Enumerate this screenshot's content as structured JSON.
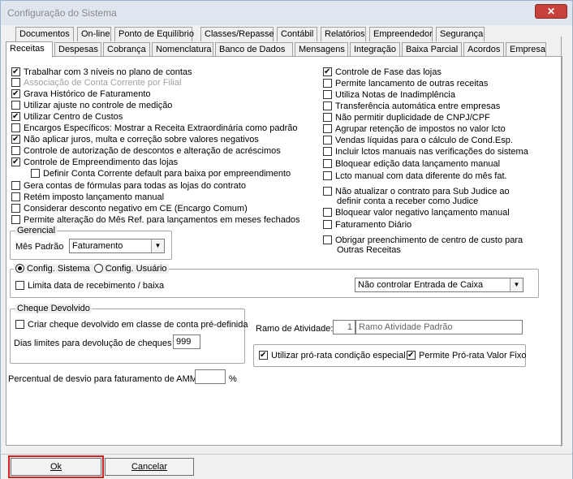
{
  "window": {
    "title": "Configuração do Sistema",
    "close_icon": "close-icon"
  },
  "tabs_row1": [
    "Documentos",
    "On-line",
    "Ponto de Equilíbrio",
    "Classes/Repasse",
    "Contábil",
    "Relatórios",
    "Empreendedor",
    "Segurança"
  ],
  "tabs_row2": [
    "Receitas",
    "Despesas",
    "Cobrança",
    "Nomenclatura",
    "Banco de Dados",
    "Mensagens",
    "Integração",
    "Baixa Parcial",
    "Acordos",
    "Empresa"
  ],
  "left_checks": [
    {
      "label": "Trabalhar com 3 níveis no plano de contas",
      "checked": true
    },
    {
      "label": "Associação de Conta Corrente por Filial",
      "checked": false,
      "disabled": true
    },
    {
      "label": "Grava Histórico de Faturamento",
      "checked": true
    },
    {
      "label": "Utilizar ajuste no controle de medição",
      "checked": false
    },
    {
      "label": "Utilizar Centro de Custos",
      "checked": true
    },
    {
      "label": "Encargos Específicos: Mostrar a Receita Extraordinária como padrão",
      "checked": false
    },
    {
      "label": "Não aplicar juros, multa e correção sobre valores negativos",
      "checked": true
    },
    {
      "label": "Controle de autorização de descontos e alteração de acréscimos",
      "checked": false
    },
    {
      "label": "Controle de Empreendimento das lojas",
      "checked": true
    },
    {
      "label": "Definir Conta Corrente default para baixa por empreendimento",
      "checked": false
    },
    {
      "label": "Gera contas de fórmulas para todas as lojas do contrato",
      "checked": false
    },
    {
      "label": "Retém imposto lançamento manual",
      "checked": false
    },
    {
      "label": "Considerar desconto negativo em CE (Encargo Comum)",
      "checked": false
    },
    {
      "label": "Permite alteração do Mês Ref. para lançamentos em meses fechados",
      "checked": false
    }
  ],
  "right_checks": [
    {
      "label": "Controle de Fase das lojas",
      "checked": true
    },
    {
      "label": "Permite lancamento de outras receitas",
      "checked": false
    },
    {
      "label": "Utiliza Notas de Inadimplência",
      "checked": false
    },
    {
      "label": "Transferência automática entre empresas",
      "checked": false
    },
    {
      "label": "Não permitir duplicidade de CNPJ/CPF",
      "checked": false
    },
    {
      "label": "Agrupar retenção de impostos no valor lcto",
      "checked": false
    },
    {
      "label": "Vendas líquidas para o cálculo de Cond.Esp.",
      "checked": false
    },
    {
      "label": "Incluir lctos manuais nas verificações do sistema",
      "checked": false
    },
    {
      "label": "Bloquear edição data lançamento manual",
      "checked": false
    },
    {
      "label": "Lcto manual com data diferente do mês fat.",
      "checked": false
    },
    {
      "label": "Não atualizar o contrato para Sub Judice ao",
      "label2": "definir conta a receber como Judice",
      "checked": false
    },
    {
      "label": "Bloquear valor negativo lançamento manual",
      "checked": false
    },
    {
      "label": "Faturamento Diário",
      "checked": false
    },
    {
      "label": "Obrigar preenchimento de centro de custo para",
      "label2": "Outras Receitas",
      "checked": false
    }
  ],
  "gerencial": {
    "title": "Gerencial",
    "label": "Mês Padrão",
    "value": "Faturamento"
  },
  "config": {
    "radio1": "Config. Sistema",
    "radio2": "Config. Usuário",
    "check": "Limita data de recebimento / baixa",
    "select": "Não controlar Entrada de Caixa"
  },
  "cheque": {
    "title": "Cheque Devolvido",
    "check": "Criar cheque devolvido em classe de conta pré-definida",
    "dias_label": "Dias limites para devolução de cheques",
    "dias_value": "999"
  },
  "ramo": {
    "label": "Ramo de Atividade:",
    "code": "1",
    "name": "Ramo Atividade Padrão"
  },
  "prorata": {
    "check1": "Utilizar pró-rata condição especial",
    "check2": "Permite Pró-rata Valor Fixo"
  },
  "desvio": {
    "label": "Percentual de desvio para faturamento de AMM",
    "unit": "%"
  },
  "buttons": {
    "ok": "Ok",
    "cancel": "Cancelar"
  },
  "highlight_color": "#d42020"
}
